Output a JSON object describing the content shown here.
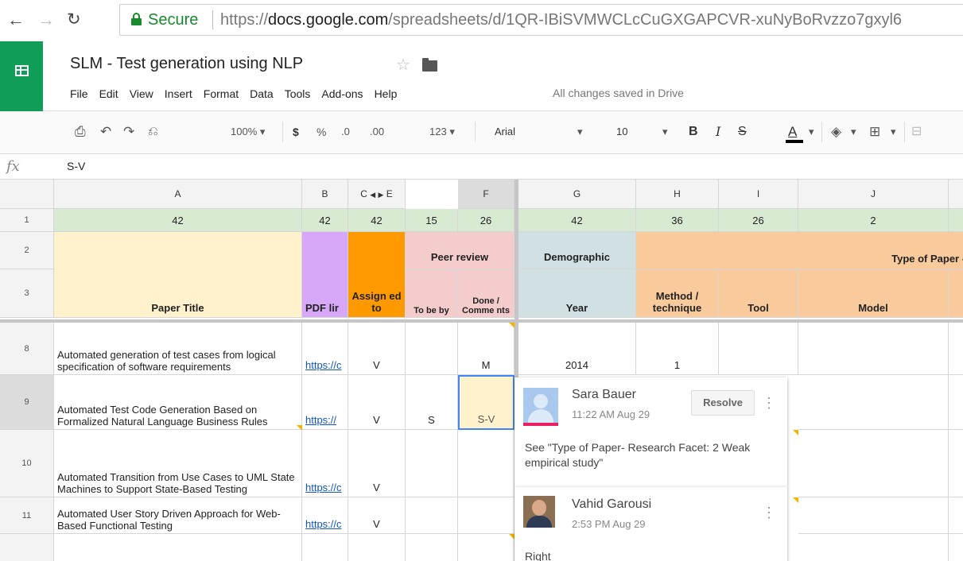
{
  "browser": {
    "secure_label": "Secure",
    "url_prefix": "https://",
    "url_host": "docs.google.com",
    "url_path": "/spreadsheets/d/1QR-IBiSVMWCLcCuGXGAPCVR-xuNyBoRvzzo7gxyl6"
  },
  "doc": {
    "title": "SLM - Test generation using NLP",
    "saved_status": "All changes saved in Drive",
    "menu": [
      "File",
      "Edit",
      "View",
      "Insert",
      "Format",
      "Data",
      "Tools",
      "Add-ons",
      "Help"
    ]
  },
  "toolbar": {
    "zoom": "100%",
    "currency": "$",
    "percent": "%",
    "dec_decrease": ".0",
    "dec_increase": ".00",
    "more_formats": "123",
    "font": "Arial",
    "font_size": "10",
    "bold": "B",
    "italic": "I",
    "strike": "S",
    "text_color": "A"
  },
  "formula_bar": {
    "fx": "fx",
    "value": "S-V"
  },
  "columns": [
    "A",
    "B",
    "C",
    "E",
    "F",
    "G",
    "H",
    "I",
    "J"
  ],
  "row_numbers": [
    "1",
    "2",
    "3",
    "8",
    "9",
    "10",
    "11"
  ],
  "row1": [
    "42",
    "42",
    "42",
    "15",
    "26",
    "42",
    "36",
    "26",
    "2"
  ],
  "headers": {
    "paper_title": "Paper Title",
    "pdf_link": "PDF lir",
    "assigned_to": "Assign ed to",
    "peer_review": "Peer review",
    "to_be_by": "To be by",
    "done_comments": "Done / Comme nts",
    "demographic": "Demographic",
    "year": "Year",
    "type_of_paper": "Type of Paper - (",
    "method": "Method / technique",
    "tool": "Tool",
    "model": "Model"
  },
  "rows": [
    {
      "title": "Automated generation of test cases from logical specification of software requirements",
      "link": "https://c",
      "assigned": "V",
      "to_be": "",
      "done": "M",
      "year": "2014",
      "method": "1"
    },
    {
      "title": "Automated Test Code Generation Based on Formalized Natural Language Business Rules",
      "link": "https://",
      "assigned": "V",
      "to_be": "S",
      "done": "S-V",
      "year": "",
      "method": ""
    },
    {
      "title": "Automated Transition from Use Cases to UML State Machines to Support State-Based Testing",
      "link": "https://c",
      "assigned": "V",
      "to_be": "",
      "done": "",
      "year": "",
      "method": ""
    },
    {
      "title": "Automated User Story Driven Approach for Web-Based Functional Testing",
      "link": "https://c",
      "assigned": "V",
      "to_be": "",
      "done": "",
      "year": "",
      "method": ""
    }
  ],
  "comments": [
    {
      "author": "Sara Bauer",
      "time": "11:22 AM Aug 29",
      "text": "See \"Type of Paper- Research Facet: 2 Weak empirical study\"",
      "resolve_label": "Resolve"
    },
    {
      "author": "Vahid Garousi",
      "time": "2:53 PM Aug 29",
      "text": "Right"
    }
  ],
  "icons": {
    "back": "arrow-left-icon",
    "forward": "arrow-right-icon",
    "reload": "reload-icon",
    "lock": "lock-icon"
  }
}
